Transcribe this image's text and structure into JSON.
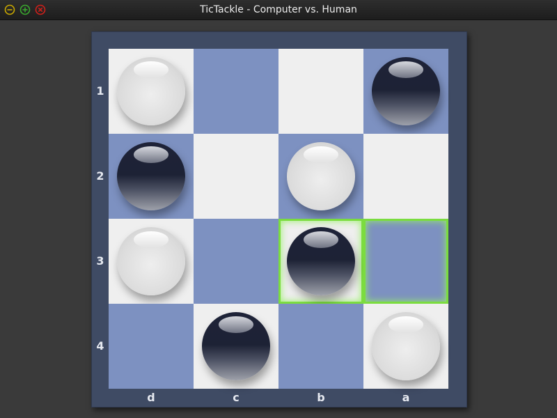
{
  "window": {
    "title": "TicTackle - Computer vs. Human",
    "controls": [
      {
        "name": "minimize",
        "color": "#c9a800"
      },
      {
        "name": "maximize",
        "color": "#3aa82e"
      },
      {
        "name": "close",
        "color": "#d0201a"
      }
    ]
  },
  "board": {
    "row_labels": [
      "1",
      "2",
      "3",
      "4"
    ],
    "column_labels": [
      "d",
      "c",
      "b",
      "a"
    ],
    "colors": {
      "light": "#efefef",
      "dark": "#7d91c1",
      "frame": "#3f4b64",
      "highlight": "#7bdc3f"
    },
    "cells": [
      [
        {
          "square": "d1",
          "shade": "light",
          "piece": "white"
        },
        {
          "square": "c1",
          "shade": "dark",
          "piece": null
        },
        {
          "square": "b1",
          "shade": "light",
          "piece": null
        },
        {
          "square": "a1",
          "shade": "dark",
          "piece": "black"
        }
      ],
      [
        {
          "square": "d2",
          "shade": "dark",
          "piece": "black"
        },
        {
          "square": "c2",
          "shade": "light",
          "piece": null
        },
        {
          "square": "b2",
          "shade": "dark",
          "piece": "white"
        },
        {
          "square": "a2",
          "shade": "light",
          "piece": null
        }
      ],
      [
        {
          "square": "d3",
          "shade": "light",
          "piece": "white"
        },
        {
          "square": "c3",
          "shade": "dark",
          "piece": null
        },
        {
          "square": "b3",
          "shade": "light",
          "piece": "black",
          "highlight": true
        },
        {
          "square": "a3",
          "shade": "dark",
          "piece": null,
          "highlight": true
        }
      ],
      [
        {
          "square": "d4",
          "shade": "dark",
          "piece": null
        },
        {
          "square": "c4",
          "shade": "light",
          "piece": "black"
        },
        {
          "square": "b4",
          "shade": "dark",
          "piece": null
        },
        {
          "square": "a4",
          "shade": "light",
          "piece": "white"
        }
      ]
    ]
  }
}
